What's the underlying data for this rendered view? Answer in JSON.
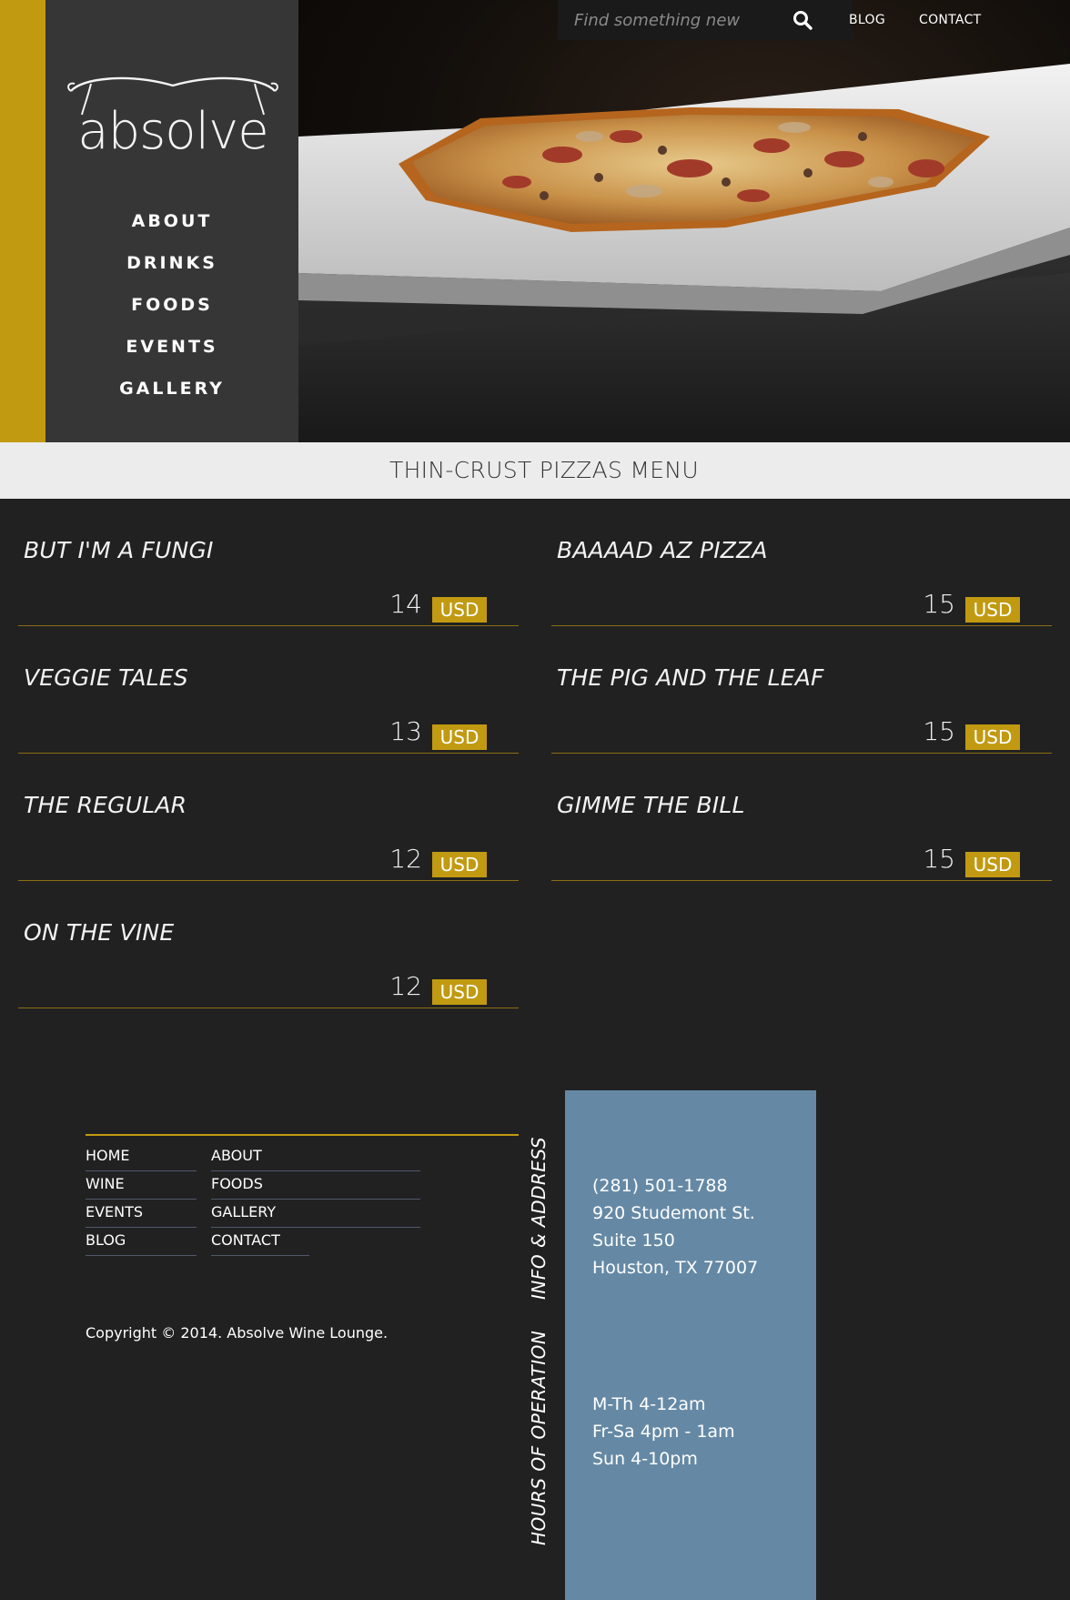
{
  "header": {
    "logo_text": "absolve",
    "nav": [
      "ABOUT",
      "DRINKS",
      "FOODS",
      "EVENTS",
      "GALLERY"
    ],
    "search_placeholder": "Find something new",
    "top_links": [
      "BLOG",
      "CONTACT"
    ]
  },
  "menu": {
    "title": "THIN-CRUST PIZZAS MENU",
    "currency": "USD",
    "left": [
      {
        "name": "BUT I'M A FUNGI",
        "price": "14"
      },
      {
        "name": "VEGGIE TALES",
        "price": "13"
      },
      {
        "name": "THE REGULAR",
        "price": "12"
      },
      {
        "name": "ON THE VINE",
        "price": "12"
      }
    ],
    "right": [
      {
        "name": "BAAAAD AZ PIZZA",
        "price": "15"
      },
      {
        "name": "THE PIG AND THE LEAF",
        "price": "15"
      },
      {
        "name": "GIMME THE BILL",
        "price": "15"
      }
    ]
  },
  "footer": {
    "nav": [
      [
        "HOME",
        "ABOUT"
      ],
      [
        "WINE",
        "FOODS"
      ],
      [
        "EVENTS",
        "GALLERY"
      ],
      [
        "BLOG",
        "CONTACT"
      ]
    ],
    "copyright": "Copyright © 2014. Absolve Wine Lounge.",
    "info_label": "INFO & ADDRESS",
    "hours_label": "HOURS OF OPERATION",
    "info": [
      "(281) 501-1788",
      "920 Studemont St.",
      "Suite 150",
      "Houston, TX 77007"
    ],
    "hours": [
      "M-Th 4-12am",
      "Fr-Sa 4pm - 1am",
      "Sun 4-10pm"
    ]
  },
  "colors": {
    "accent": "#c19a12",
    "info_box": "#6589a5",
    "background": "#212121"
  }
}
